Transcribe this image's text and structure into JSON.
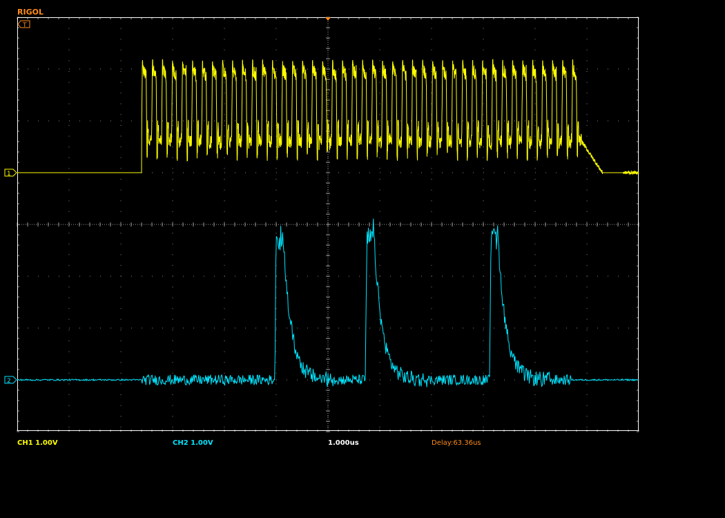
{
  "brand": {
    "name": "RIGOL",
    "color": "#ff8c1a"
  },
  "trigger_marker": {
    "label": "T",
    "icon": "trigger-flag-icon",
    "color": "#ff8c1a"
  },
  "channels": [
    {
      "id": "ch1",
      "marker": "1",
      "label": "CH1 1.00V",
      "color": "#ffff00"
    },
    {
      "id": "ch2",
      "marker": "2",
      "label": "CH2 1.00V",
      "color": "#00e5ff"
    }
  ],
  "timebase": {
    "label": "1.000us",
    "color": "#ffffff"
  },
  "delay": {
    "label": "Delay:63.36us",
    "color": "#ff8c1a"
  },
  "chart_data": {
    "type": "line",
    "title": "",
    "xlabel": "",
    "ylabel": "",
    "grid": true,
    "x_unit": "us",
    "y_unit": "V",
    "xlim": [
      -6.0,
      6.0
    ],
    "ylim": [
      -4.0,
      4.0
    ],
    "series": [
      {
        "name": "CH1",
        "color": "#ffff00",
        "baseline_v": 1.0,
        "envelope": {
          "start_us": -3.6,
          "end_us": 4.9,
          "fade_end_us": 5.0,
          "low_v": 1.6,
          "high_v": 3.0,
          "peak_v": 3.2
        },
        "cycles": 44
      },
      {
        "name": "CH2",
        "color": "#00e5ff",
        "baseline_v": -3.0,
        "noise_v": 0.1,
        "noise_span_us": [
          -3.6,
          4.7
        ],
        "pulses": [
          {
            "t_us": -1.0,
            "peak_v": 0.0,
            "decay_us": 0.35
          },
          {
            "t_us": 0.75,
            "peak_v": 0.1,
            "decay_us": 0.35
          },
          {
            "t_us": 3.15,
            "peak_v": 0.0,
            "decay_us": 0.35
          }
        ]
      }
    ]
  }
}
